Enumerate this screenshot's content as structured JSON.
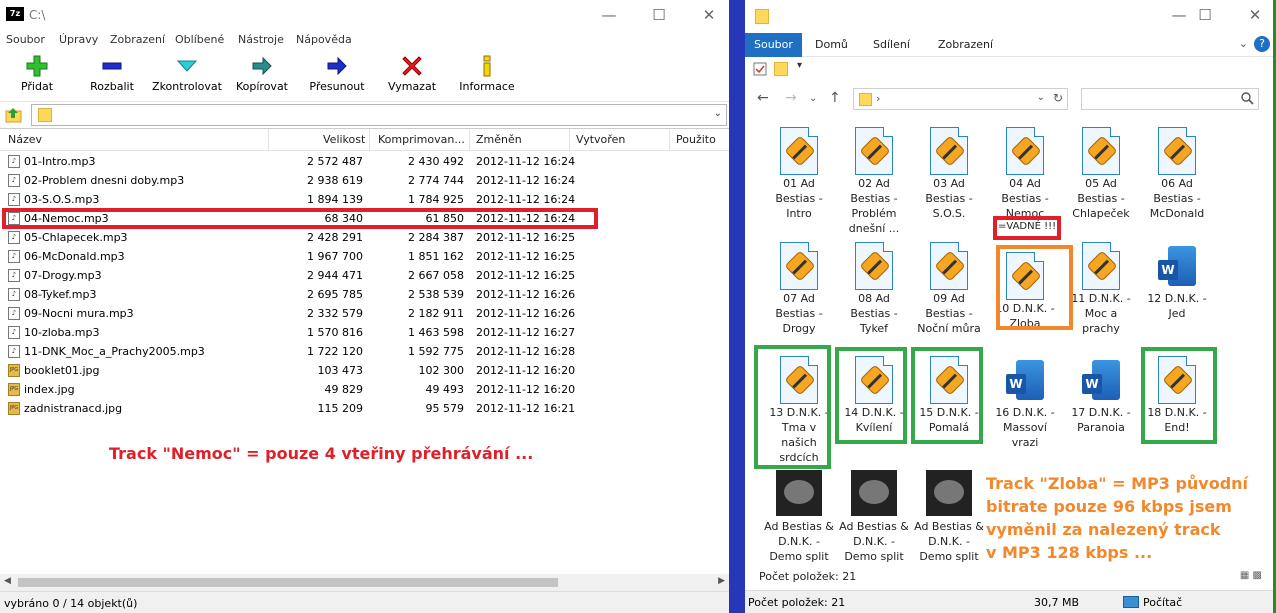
{
  "zip": {
    "title": "C:\\",
    "menu": [
      "Soubor",
      "Úpravy",
      "Zobrazení",
      "Oblíbené",
      "Nástroje",
      "Nápověda"
    ],
    "toolbar": {
      "add": "Přidat",
      "extract": "Rozbalit",
      "test": "Zkontrolovat",
      "copy": "Kopírovat",
      "move": "Přesunout",
      "delete": "Vymazat",
      "info": "Informace"
    },
    "columns": {
      "name": "Název",
      "size": "Velikost",
      "packed": "Komprimovan...",
      "modified": "Změněn",
      "created": "Vytvořen",
      "used": "Použito"
    },
    "rows": [
      {
        "name": "01-Intro.mp3",
        "size": "2 572 487",
        "packed": "2 430 492",
        "modified": "2012-11-12 16:24",
        "type": "mp3"
      },
      {
        "name": "02-Problem dnesni doby.mp3",
        "size": "2 938 619",
        "packed": "2 774 744",
        "modified": "2012-11-12 16:24",
        "type": "mp3"
      },
      {
        "name": "03-S.O.S.mp3",
        "size": "1 894 139",
        "packed": "1 784 925",
        "modified": "2012-11-12 16:24",
        "type": "mp3"
      },
      {
        "name": "04-Nemoc.mp3",
        "size": "68 340",
        "packed": "61 850",
        "modified": "2012-11-12 16:24",
        "type": "mp3"
      },
      {
        "name": "05-Chlapecek.mp3",
        "size": "2 428 291",
        "packed": "2 284 387",
        "modified": "2012-11-12 16:25",
        "type": "mp3"
      },
      {
        "name": "06-McDonald.mp3",
        "size": "1 967 700",
        "packed": "1 851 162",
        "modified": "2012-11-12 16:25",
        "type": "mp3"
      },
      {
        "name": "07-Drogy.mp3",
        "size": "2 944 471",
        "packed": "2 667 058",
        "modified": "2012-11-12 16:25",
        "type": "mp3"
      },
      {
        "name": "08-Tykef.mp3",
        "size": "2 695 785",
        "packed": "2 538 539",
        "modified": "2012-11-12 16:26",
        "type": "mp3"
      },
      {
        "name": "09-Nocni mura.mp3",
        "size": "2 332 579",
        "packed": "2 182 911",
        "modified": "2012-11-12 16:26",
        "type": "mp3"
      },
      {
        "name": "10-zloba.mp3",
        "size": "1 570 816",
        "packed": "1 463 598",
        "modified": "2012-11-12 16:27",
        "type": "mp3"
      },
      {
        "name": "11-DNK_Moc_a_Prachy2005.mp3",
        "size": "1 722 120",
        "packed": "1 592 775",
        "modified": "2012-11-12 16:28",
        "type": "mp3"
      },
      {
        "name": "booklet01.jpg",
        "size": "103 473",
        "packed": "102 300",
        "modified": "2012-11-12 16:20",
        "type": "jpg"
      },
      {
        "name": "index.jpg",
        "size": "49 829",
        "packed": "49 493",
        "modified": "2012-11-12 16:20",
        "type": "jpg"
      },
      {
        "name": "zadnistranacd.jpg",
        "size": "115 209",
        "packed": "95 579",
        "modified": "2012-11-12 16:21",
        "type": "jpg"
      }
    ],
    "annotation": "Track \"Nemoc\" = pouze 4  vteřiny přehrávání ...",
    "status": "vybráno 0 / 14 objekt(ů)",
    "logo": "7z"
  },
  "explorer": {
    "tabs": [
      "Soubor",
      "Domů",
      "Sdílení",
      "Zobrazení"
    ],
    "items": [
      {
        "label": "01 Ad Bestias - Intro",
        "kind": "mp3"
      },
      {
        "label": "02 Ad Bestias - Problém dnešní ...",
        "kind": "mp3"
      },
      {
        "label": "03 Ad Bestias - S.O.S.",
        "kind": "mp3"
      },
      {
        "label": "04 Ad Bestias - Nemoc",
        "kind": "mp3"
      },
      {
        "label": "05 Ad Bestias - Chlapeček",
        "kind": "mp3"
      },
      {
        "label": "06 Ad Bestias - McDonald",
        "kind": "mp3"
      },
      {
        "label": "07 Ad Bestias - Drogy",
        "kind": "mp3"
      },
      {
        "label": "08 Ad Bestias - Tykef",
        "kind": "mp3"
      },
      {
        "label": "09 Ad Bestias - Noční můra",
        "kind": "mp3"
      },
      {
        "label": "10 D.N.K. - Zloba",
        "kind": "mp3"
      },
      {
        "label": "11 D.N.K. - Moc a prachy",
        "kind": "mp3"
      },
      {
        "label": "12 D.N.K. - Jed",
        "kind": "word"
      },
      {
        "label": "13 D.N.K. - Tma v našich srdcích",
        "kind": "mp3"
      },
      {
        "label": "14 D.N.K. - Kvílení",
        "kind": "mp3"
      },
      {
        "label": "15 D.N.K. - Pomalá",
        "kind": "mp3"
      },
      {
        "label": "16 D.N.K. - Massoví vrazi",
        "kind": "word"
      },
      {
        "label": "17 D.N.K. - Paranoia",
        "kind": "word"
      },
      {
        "label": "18 D.N.K. - End!",
        "kind": "mp3"
      },
      {
        "label": "Ad Bestias & D.N.K. - Demo split",
        "kind": "image"
      },
      {
        "label": "Ad Bestias & D.N.K. - Demo split",
        "kind": "image"
      },
      {
        "label": "Ad Bestias & D.N.K. - Demo split",
        "kind": "image"
      }
    ],
    "vadne_label": "=VADNÉ !!!",
    "annotation_lines": [
      "Track \"Zloba\" = MP3 původní",
      "bitrate pouze 96 kbps jsem",
      "vyměnil za nalezený track",
      "v MP3 128 kbps ..."
    ],
    "count_inner": "Počet položek: 21",
    "status": {
      "count": "Počet položek: 21",
      "size": "30,7 MB",
      "location": "Počítač"
    }
  },
  "colors": {
    "red_box": "#e02028",
    "green_box": "#35a84a",
    "orange_box": "#f2882b",
    "ribbon_active": "#1f6fc5",
    "desktop_bg": "#2638b8"
  }
}
